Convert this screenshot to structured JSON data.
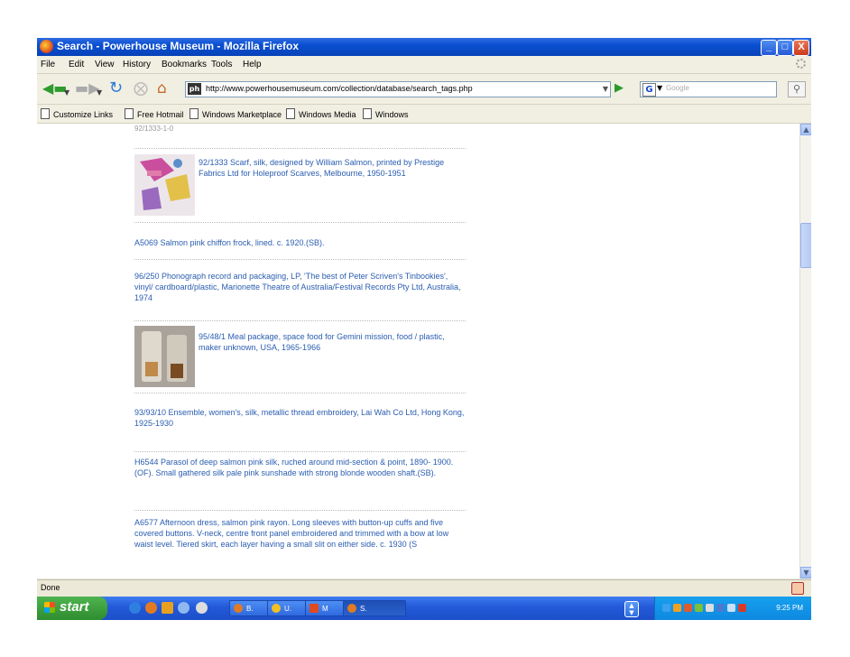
{
  "window": {
    "title": "Search - Powerhouse Museum - Mozilla Firefox",
    "min_label": "_",
    "max_label": "□",
    "close_label": "X"
  },
  "menu": [
    "File",
    "Edit",
    "View",
    "History",
    "Bookmarks",
    "Tools",
    "Help"
  ],
  "nav": {
    "back_icon": "back-arrow-icon",
    "forward_icon": "forward-arrow-icon",
    "url": "http://www.powerhousemuseum.com/collection/database/search_tags.php",
    "favicon_text": "ph",
    "search_placeholder": "Google",
    "search_engine_letter": "G"
  },
  "bookmarks": [
    "Customize Links",
    "Free Hotmail",
    "Windows Marketplace",
    "Windows Media",
    "Windows"
  ],
  "results": {
    "top_partial": "92/1333-1-0",
    "items": [
      "92/1333 Scarf, silk, designed by William Salmon, printed by Prestige Fabrics Ltd for Holeproof Scarves, Melbourne, 1950-1951",
      "A5069 Salmon pink chiffon frock, lined. c. 1920.(SB).",
      "96/250 Phonograph record and packaging, LP, 'The best of Peter Scriven's Tinbookies', vinyl/ cardboard/plastic, Marionette Theatre of Australia/Festival Records Pty Ltd, Australia, 1974",
      "95/48/1 Meal package, space food for Gemini mission, food / plastic, maker unknown, USA, 1965-1966",
      "93/93/10 Ensemble, women's, silk, metallic thread embroidery, Lai Wah Co Ltd, Hong Kong, 1925-1930",
      "H6544 Parasol of deep salmon pink silk, ruched around mid-section & point, 1890- 1900.(OF). Small gathered silk pale pink sunshade with strong blonde wooden shaft.(SB).",
      "A6577 Afternoon dress, salmon pink rayon. Long sleeves with button-up cuffs and five covered buttons. V-neck, centre front panel embroidered and trimmed with a bow at low waist level. Tiered skirt, each layer having a small slit on either side. c. 1930 (S"
    ]
  },
  "status": {
    "text": "Done"
  },
  "taskbar": {
    "start_label": "start",
    "tasks": [
      "B.",
      "U.",
      "M",
      "S."
    ],
    "clock": "9:25 PM"
  },
  "colors": {
    "titlebar": "#0a4fd1",
    "link": "#2a5db0",
    "taskbar": "#2358d8",
    "start": "#2e8c2e"
  }
}
